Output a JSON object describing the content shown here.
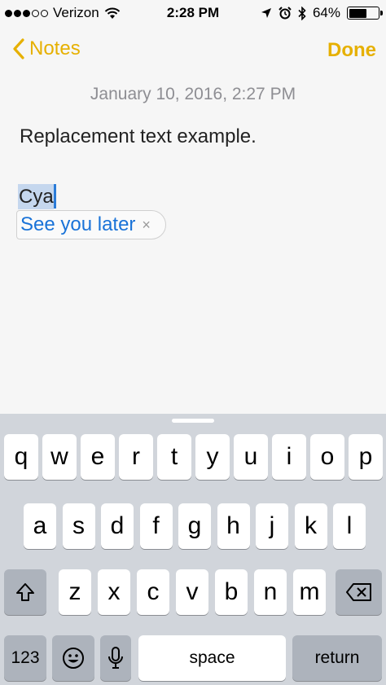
{
  "status_bar": {
    "carrier": "Verizon",
    "time": "2:28 PM",
    "battery_percent": "64%",
    "battery_level": 0.64,
    "signal_bars_filled": 3,
    "signal_bars_total": 5
  },
  "nav": {
    "back_label": "Notes",
    "done_label": "Done"
  },
  "note": {
    "date": "January 10, 2016, 2:27 PM",
    "line1": "Replacement text example.",
    "typed_text": "Cya"
  },
  "suggestion": {
    "text": "See you later",
    "dismiss": "×"
  },
  "keyboard": {
    "row1": [
      "q",
      "w",
      "e",
      "r",
      "t",
      "y",
      "u",
      "i",
      "o",
      "p"
    ],
    "row2": [
      "a",
      "s",
      "d",
      "f",
      "g",
      "h",
      "j",
      "k",
      "l"
    ],
    "row3": [
      "z",
      "x",
      "c",
      "v",
      "b",
      "n",
      "m"
    ],
    "numbers_label": "123",
    "space_label": "space",
    "return_label": "return"
  },
  "colors": {
    "accent": "#e6b000",
    "suggestion_text": "#1a73d8",
    "selection": "#c5d7ee"
  }
}
